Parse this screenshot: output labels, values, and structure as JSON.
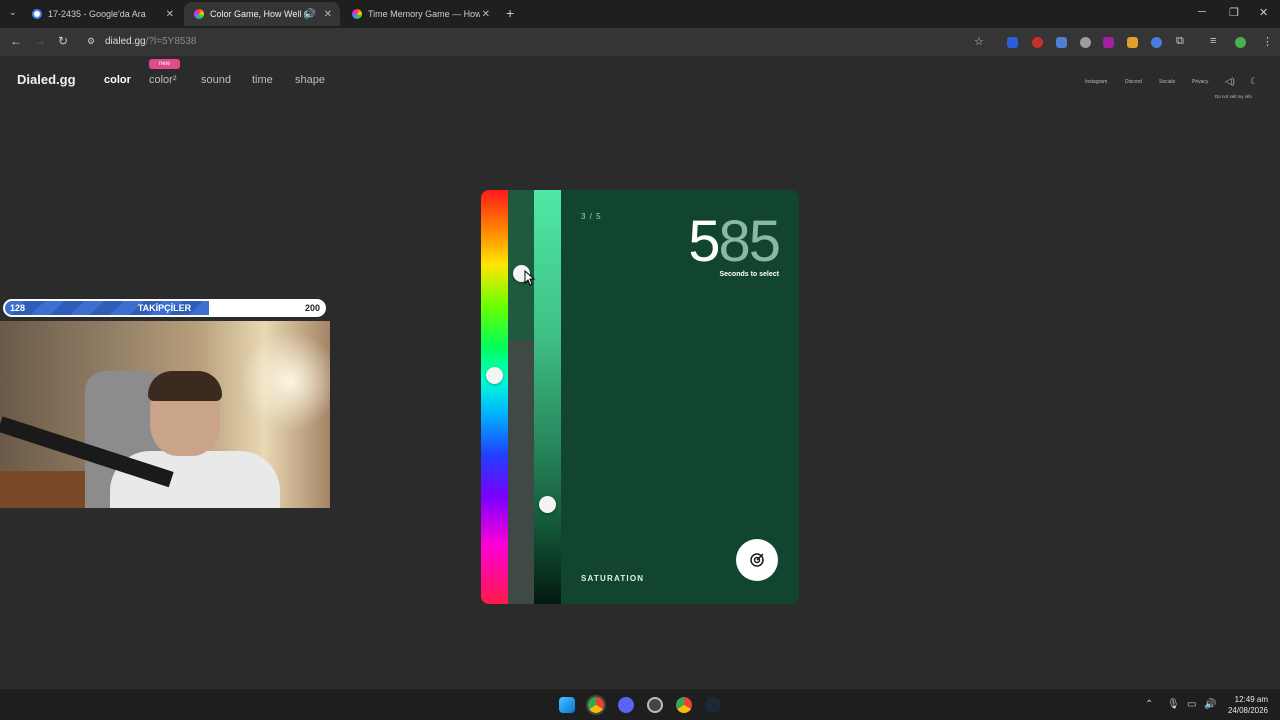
{
  "browser": {
    "tabs": [
      {
        "title": "17-2435 - Google'da Ara",
        "active": false
      },
      {
        "title": "Color Game, How Well Can",
        "active": true
      },
      {
        "title": "Time Memory Game — How G",
        "active": false
      }
    ],
    "url_host": "dialed.gg",
    "url_path": "/?l=5Y8538"
  },
  "site": {
    "logo": "Dialed.gg",
    "nav": [
      "color",
      "color²",
      "sound",
      "time",
      "shape"
    ],
    "new_badge": "new",
    "right_links": [
      "Instagram",
      "Discord",
      "Socials",
      "Privacy"
    ],
    "do_not_sell": "Do not sell my info"
  },
  "overlay": {
    "followers_min": "128",
    "followers_label": "TAKİPÇİLER",
    "followers_max": "200",
    "followers_progress": 0.64
  },
  "game": {
    "round": "3 / 5",
    "timer_first": "5",
    "timer_rest": "85",
    "timer_caption": "Seconds to select",
    "mode": "SATURATION",
    "colors": {
      "card_bg": "#114530",
      "accent": "#4fe8a5"
    }
  },
  "taskbar": {
    "time": "12:49 am",
    "date": "24/08/2026"
  }
}
